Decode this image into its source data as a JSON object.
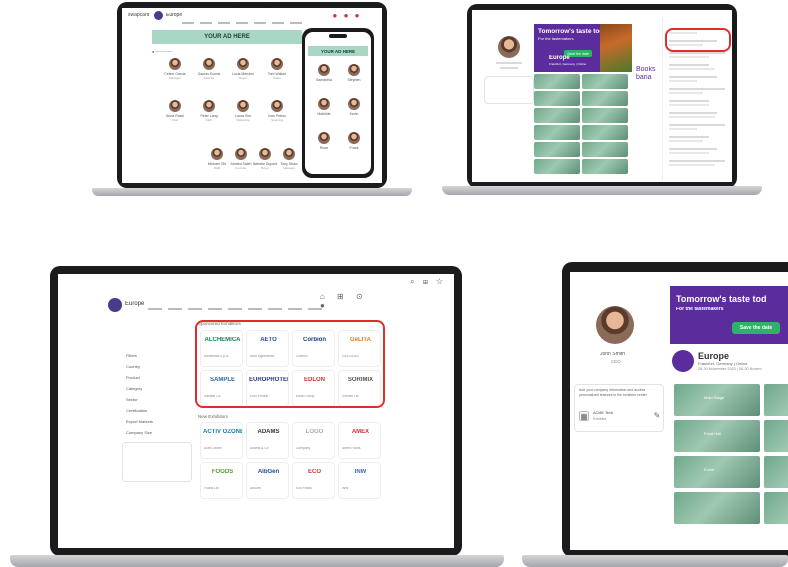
{
  "laptop1": {
    "logo": "swapcard",
    "event": "Europe",
    "ad_banner": "YOUR AD HERE",
    "ad_banner_mobile": "YOUR AD HERE",
    "people": [
      {
        "name": "Celine Garcia",
        "role": "Manager"
      },
      {
        "name": "Gaurav Kumar",
        "role": "Director"
      },
      {
        "name": "Lucia Mendes",
        "role": "Buyer"
      },
      {
        "name": "Tom Walker",
        "role": "Sales"
      },
      {
        "name": "Anna Rossi",
        "role": "Chef"
      },
      {
        "name": "Peter Lang",
        "role": "CEO"
      },
      {
        "name": "Laura Kim",
        "role": "Marketing"
      },
      {
        "name": "Ivan Petrov",
        "role": "Sourcing"
      },
      {
        "name": "Michael Obi",
        "role": "R&D"
      },
      {
        "name": "Ahmed Saleh",
        "role": "Founder"
      },
      {
        "name": "Isabelle Dupont",
        "role": "Buyer"
      },
      {
        "name": "Tony Shaw",
        "role": "Manager"
      }
    ],
    "mobile_people": [
      {
        "name": "Samantha"
      },
      {
        "name": "Stephen"
      },
      {
        "name": "Mathilde"
      },
      {
        "name": "Kevin"
      },
      {
        "name": "Rose"
      },
      {
        "name": "Frank"
      }
    ]
  },
  "laptop2": {
    "banner_title": "Tomorrow's taste today",
    "banner_sub": "For the tastemakers",
    "cta": "Save the date",
    "event": "Europe",
    "event_meta": "Frankfurt, Germany | Online",
    "side_text": "Books bana"
  },
  "laptop3": {
    "event": "Europe",
    "section_title": "Sponsored Exhibitors",
    "section2_title": "New Exhibitors",
    "sidebar_items": [
      "Filters",
      "Country",
      "Product",
      "Category",
      "Sector",
      "Certification",
      "Export Markets",
      "Company Size"
    ],
    "sponsored": [
      {
        "logo": "ALCHEMICA",
        "caption": "Alchemica S.p.A."
      },
      {
        "logo": "AETO",
        "caption": "Aeto Ingredients"
      },
      {
        "logo": "Corbion",
        "caption": "Corbion"
      },
      {
        "logo": "GeLITA",
        "caption": "GELITA AG"
      },
      {
        "logo": "SAMPLE",
        "caption": "Sample Co."
      },
      {
        "logo": "EUROPROTEIN",
        "caption": "Euro Protein"
      },
      {
        "logo": "EDLON",
        "caption": "Edlon Group"
      },
      {
        "logo": "SORIMIX",
        "caption": "Sorimix Ltd"
      }
    ],
    "new": [
      {
        "logo": "ACTIV OZONE",
        "caption": "Activ Ozone"
      },
      {
        "logo": "ADAMS",
        "caption": "Adams & Co"
      },
      {
        "logo": "LOGO",
        "caption": "Company"
      },
      {
        "logo": "AMEX",
        "caption": "Amex Foods"
      },
      {
        "logo": "FOODS",
        "caption": "Foods Ltd"
      },
      {
        "logo": "AlbGen",
        "caption": "AlbGen"
      },
      {
        "logo": "ECO",
        "caption": "Eco Foods"
      },
      {
        "logo": "INW",
        "caption": "INW"
      }
    ]
  },
  "laptop4": {
    "banner_title": "Tomorrow's taste tod",
    "banner_sub": "For the tastemakers",
    "cta": "Save the date",
    "event": "Europe",
    "event_meta": "Frankfurt, Germany | Online",
    "event_dates": "28-30 November 2023 | 06-30 Novem",
    "person_name": "John Smith",
    "person_role": "CEO",
    "card_text": "Add your company information and access personalized features in the exhibitor center",
    "card_item": "ACME Tech",
    "card_sub": "Exhibitor",
    "tile_labels": [
      "Main Stage",
      "Food Hall",
      "Event"
    ]
  }
}
